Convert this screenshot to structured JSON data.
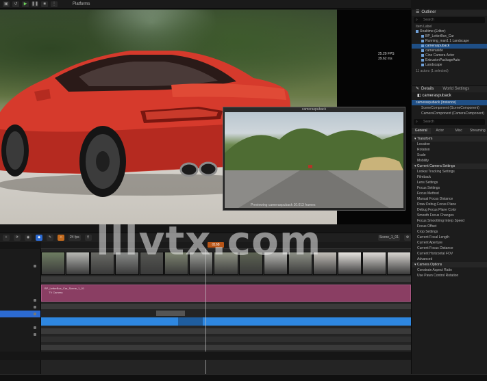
{
  "toolbar": {
    "platforms_label": "Platforms"
  },
  "viewport": {
    "fps_line1": "25.29 FPS",
    "fps_line2": "39.62 ms"
  },
  "preview": {
    "title": "cameraspuback",
    "footer": "Previewing cameraspuback 10.013 frames"
  },
  "outliner": {
    "title": "Outliner",
    "search_placeholder": "Search",
    "column_label": "Item Label",
    "rows": [
      {
        "label": "Realtime (Editor)",
        "selected": false
      },
      {
        "label": "BP_LetterBox_Car",
        "selected": false
      },
      {
        "label": "Running_man1 1 Landscape",
        "selected": false
      },
      {
        "label": "cameraspuback",
        "selected": true
      },
      {
        "label": "cameraside",
        "selected": false
      },
      {
        "label": "Cine Camera Actor",
        "selected": false
      },
      {
        "label": "ExtrusionPackageAuto",
        "selected": false
      },
      {
        "label": "Landscape",
        "selected": false
      }
    ],
    "footer": "11 actors (1 selected)"
  },
  "details": {
    "title": "Details",
    "world_settings": "World Settings",
    "selected_name": "cameraspuback",
    "components": [
      {
        "label": "cameraspuback (Instance)",
        "selected": true
      },
      {
        "label": "SceneComponent (SceneComponent)",
        "selected": false
      },
      {
        "label": "CameraComponent (CameraComponent)",
        "selected": false
      }
    ],
    "search_placeholder": "Search",
    "tabs": [
      "General",
      "Actor",
      "Misc",
      "Streaming"
    ],
    "active_tab": 0,
    "rows": [
      {
        "label": "Transform",
        "section": true
      },
      {
        "label": "Location",
        "section": false
      },
      {
        "label": "Rotation",
        "section": false
      },
      {
        "label": "Scale",
        "section": false
      },
      {
        "label": "Mobility",
        "section": false
      },
      {
        "label": "Current Camera Settings",
        "section": true
      },
      {
        "label": "Lookat Tracking Settings",
        "section": false
      },
      {
        "label": "Filmback",
        "section": false
      },
      {
        "label": "Lens Settings",
        "section": false
      },
      {
        "label": "Focus Settings",
        "section": false
      },
      {
        "label": "Focus Method",
        "section": false
      },
      {
        "label": "Manual Focus Distance",
        "section": false
      },
      {
        "label": "Draw Debug Focus Plane",
        "section": false
      },
      {
        "label": "Debug Focus Plane Color",
        "section": false
      },
      {
        "label": "Smooth Focus Changes",
        "section": false
      },
      {
        "label": "Focus Smoothing Interp Speed",
        "section": false
      },
      {
        "label": "Focus Offset",
        "section": false
      },
      {
        "label": "Crop Settings",
        "section": false
      },
      {
        "label": "Current Focal Length",
        "section": false
      },
      {
        "label": "Current Aperture",
        "section": false
      },
      {
        "label": "Current Focus Distance",
        "section": false
      },
      {
        "label": "Current Horizontal FOV",
        "section": false
      },
      {
        "label": "Advanced",
        "section": false
      },
      {
        "label": "Camera Options",
        "section": true
      },
      {
        "label": "Constrain Aspect Ratio",
        "section": false
      },
      {
        "label": "Use Pawn Control Rotation",
        "section": false
      }
    ]
  },
  "sequencer": {
    "fps_label": "24 fps",
    "current_time": "0000",
    "sequence_name": "Scene_1_01",
    "marker_label": "0168",
    "shot_label": "BP_LetterBox_Car_Scene_1_01",
    "shot_sub": "TV Camera",
    "track_rows": [
      {
        "label": "",
        "selected": false
      },
      {
        "label": "",
        "selected": false
      },
      {
        "label": "",
        "selected": false
      },
      {
        "label": "",
        "selected": false
      },
      {
        "label": "",
        "selected": false
      },
      {
        "label": "",
        "selected": false
      },
      {
        "label": "",
        "selected": false
      },
      {
        "label": "",
        "selected": false
      },
      {
        "label": "",
        "selected": false
      },
      {
        "label": "",
        "selected": true
      },
      {
        "label": "",
        "selected": false
      },
      {
        "label": "",
        "selected": false
      },
      {
        "label": "",
        "selected": false
      },
      {
        "label": "",
        "selected": false
      }
    ],
    "thumb_colors": [
      "#6e7d62",
      "#b7b8b4",
      "#6a6b66",
      "#8a8c8a",
      "#555652",
      "#7e8571",
      "#9ea09a",
      "#8f9384",
      "#5d6353",
      "#b9b9b5",
      "#8c8f85",
      "#c2beb8",
      "#e8e5e1",
      "#dedbd7",
      "#d9d6d2"
    ]
  },
  "watermark": "lllvtx.com",
  "colors": {
    "accent_blue": "#2c6ad1",
    "shot_purple": "#8a3e63",
    "car_red": "#d63a2c",
    "marker_orange": "#b85517"
  }
}
